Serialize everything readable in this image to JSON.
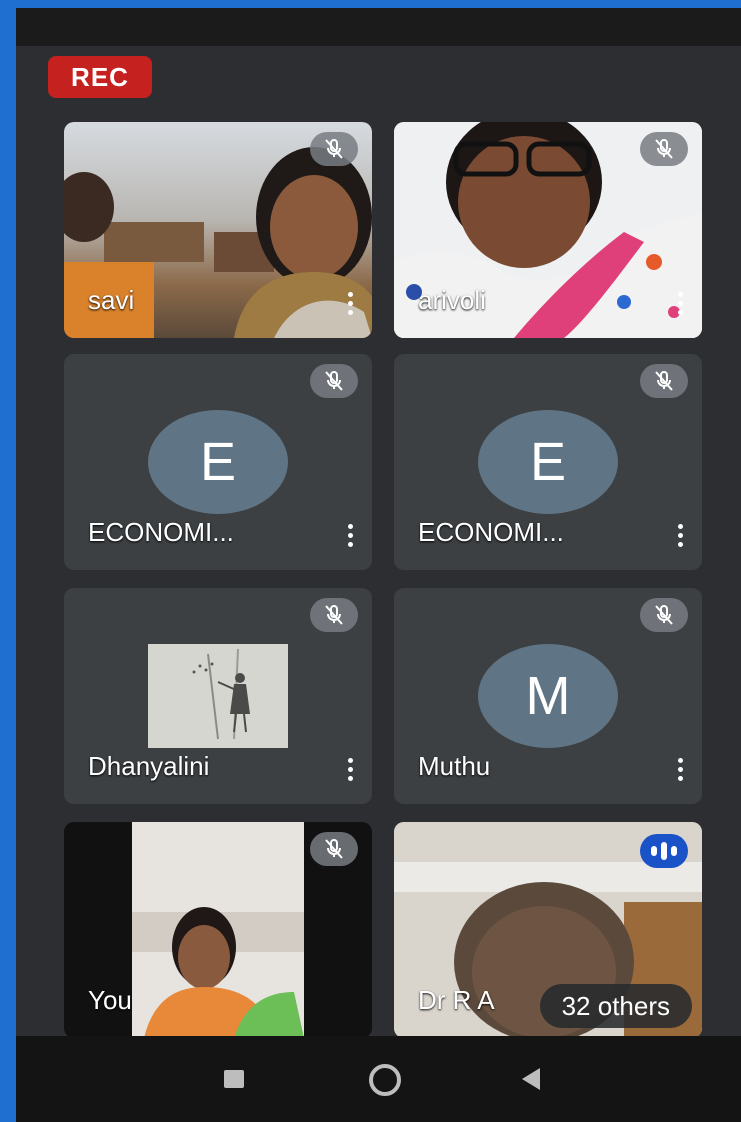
{
  "recording": {
    "label": "REC",
    "color": "#c5221f"
  },
  "tiles": [
    {
      "name": "savi",
      "muted": true,
      "type": "video"
    },
    {
      "name": "arivoli",
      "muted": true,
      "type": "video"
    },
    {
      "name": "ECONOMI...",
      "avatar_letter": "E",
      "muted": true,
      "type": "avatar"
    },
    {
      "name": "ECONOMI...",
      "avatar_letter": "E",
      "muted": true,
      "type": "avatar"
    },
    {
      "name": "Dhanyalini",
      "muted": true,
      "type": "avatar-image"
    },
    {
      "name": "Muthu",
      "avatar_letter": "M",
      "muted": true,
      "type": "avatar"
    },
    {
      "name": "You",
      "muted": true,
      "type": "video"
    },
    {
      "name": "Dr R A",
      "speaking": true,
      "type": "video",
      "others_label": "32 others"
    }
  ],
  "colors": {
    "tile_bg": "#3c4043",
    "avatar_bg": "#5f7484",
    "speaking_badge": "#1a52c7"
  },
  "icons": [
    "mic-off-icon",
    "more-vert-icon",
    "speaking-icon",
    "nav-recents-icon",
    "nav-home-icon",
    "nav-back-icon"
  ]
}
